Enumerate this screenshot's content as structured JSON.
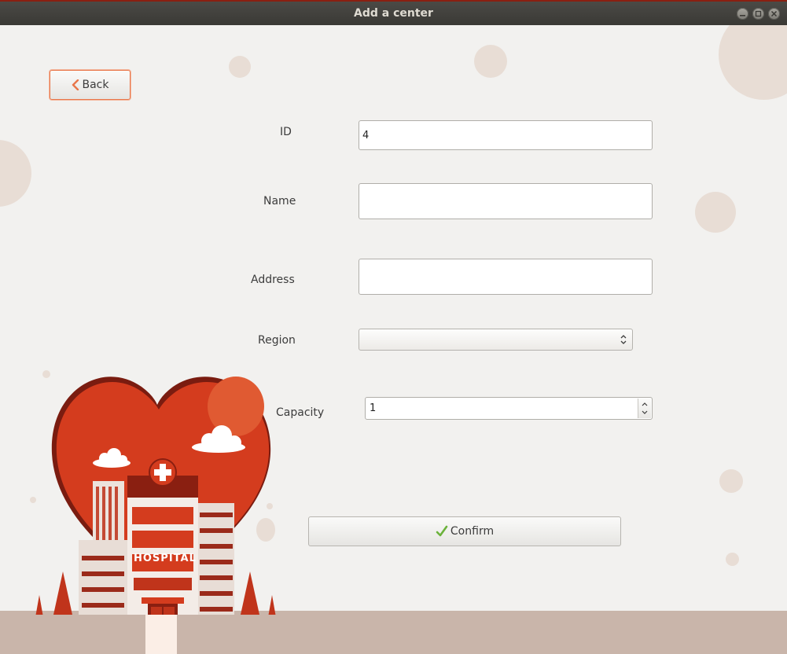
{
  "window": {
    "title": "Add a center"
  },
  "back_button": {
    "label": "Back",
    "icon": "chevron-left-icon"
  },
  "form": {
    "id": {
      "label": "ID",
      "value": "4"
    },
    "name": {
      "label": "Name",
      "value": ""
    },
    "address": {
      "label": "Address",
      "value": ""
    },
    "region": {
      "label": "Region",
      "value": ""
    },
    "capacity": {
      "label": "Capacity",
      "value": "1"
    }
  },
  "confirm_button": {
    "label": "Confirm",
    "icon": "check-icon"
  },
  "illustration": {
    "sign": "HOSPITAL"
  },
  "colors": {
    "accent": "#e8764a",
    "heart": "#d43c1e",
    "ground": "#c9b5aa"
  }
}
